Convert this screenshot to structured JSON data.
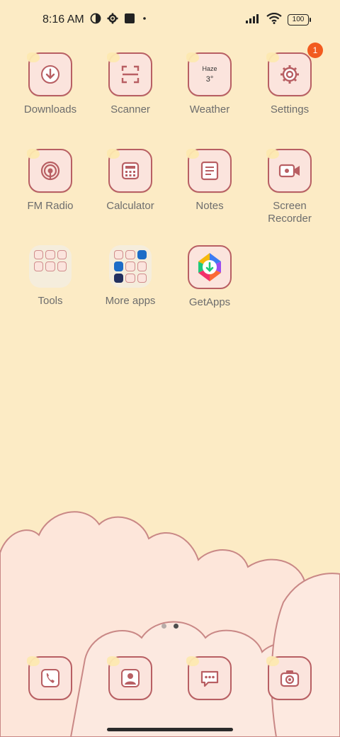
{
  "status_bar": {
    "time": "8:16 AM",
    "battery": "100",
    "left_icons": [
      "theme-icon",
      "gear-icon",
      "square-icon",
      "dot-icon"
    ],
    "right_icons": [
      "signal-icon",
      "wifi-icon",
      "battery-icon"
    ]
  },
  "apps": [
    {
      "label": "Downloads",
      "icon": "download-icon"
    },
    {
      "label": "Scanner",
      "icon": "scanner-icon"
    },
    {
      "label": "Weather",
      "icon": "weather-icon",
      "weather_text": "Haze",
      "weather_temp": "3°"
    },
    {
      "label": "Settings",
      "icon": "gear-icon",
      "badge": "1"
    },
    {
      "label": "FM Radio",
      "icon": "radio-icon"
    },
    {
      "label": "Calculator",
      "icon": "calculator-icon"
    },
    {
      "label": "Notes",
      "icon": "notes-icon"
    },
    {
      "label": "Screen\nRecorder",
      "icon": "video-camera-icon"
    },
    {
      "label": "Tools",
      "icon": "folder-icon"
    },
    {
      "label": "More apps",
      "icon": "folder-icon"
    },
    {
      "label": "GetApps",
      "icon": "getapps-icon"
    }
  ],
  "dock": [
    {
      "icon": "phone-icon"
    },
    {
      "icon": "contacts-icon"
    },
    {
      "icon": "messages-icon"
    },
    {
      "icon": "camera-icon"
    }
  ],
  "pages": {
    "current": 2,
    "total": 2
  },
  "colors": {
    "accent": "#b85f63",
    "tile": "#fbe4dd",
    "diamond": "#fcebc5",
    "badge": "#f25b1f"
  }
}
